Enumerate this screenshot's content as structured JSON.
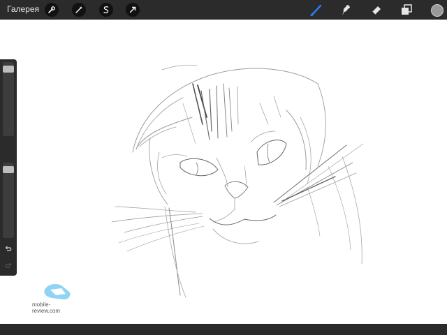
{
  "topbar": {
    "gallery_label": "Галерея",
    "left_tools": [
      {
        "name": "actions-wrench-icon"
      },
      {
        "name": "adjustments-wand-icon"
      },
      {
        "name": "selection-s-icon"
      },
      {
        "name": "transform-arrow-icon"
      }
    ],
    "right_tools": [
      {
        "name": "brush-icon",
        "active": true
      },
      {
        "name": "smudge-icon"
      },
      {
        "name": "eraser-icon"
      },
      {
        "name": "layers-icon"
      }
    ],
    "current_color": "#9a9a9a",
    "active_color": "#2d7cf6"
  },
  "sidebar": {
    "brush_size_level": 0.05,
    "opacity_level": 0.05,
    "undo_icon": "undo-arrow-icon",
    "redo_icon": "redo-arrow-icon"
  },
  "watermark": {
    "text": "mobile-review.com"
  }
}
